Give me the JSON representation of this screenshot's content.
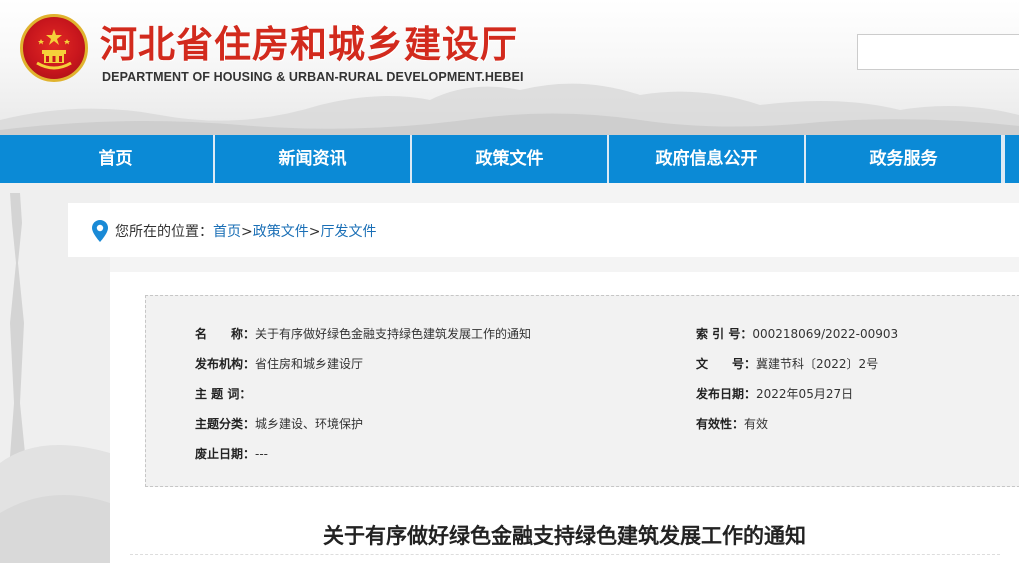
{
  "header": {
    "title": "河北省住房和城乡建设厅",
    "subtitle": "DEPARTMENT OF HOUSING & URBAN-RURAL DEVELOPMENT.HEBEI",
    "search_placeholder": ""
  },
  "nav": {
    "items": [
      "首页",
      "新闻资讯",
      "政策文件",
      "政府信息公开",
      "政务服务"
    ]
  },
  "breadcrumb": {
    "prefix": "您所在的位置：",
    "items": [
      "首页",
      "政策文件",
      "厅发文件"
    ],
    "separator": ">"
  },
  "info": {
    "name_label": "名　　称：",
    "name_value": "关于有序做好绿色金融支持绿色建筑发展工作的通知",
    "index_label": "索 引 号：",
    "index_value": "000218069/2022-00903",
    "org_label": "发布机构：",
    "org_value": "省住房和城乡建设厅",
    "docno_label": "文　　号：",
    "docno_value": "冀建节科〔2022〕2号",
    "subject_label": "主 题 词：",
    "subject_value": "",
    "date_label": "发布日期：",
    "date_value": "2022年05月27日",
    "category_label": "主题分类：",
    "category_value": "城乡建设、环境保护",
    "validity_label": "有效性：",
    "validity_value": "有效",
    "expire_label": "废止日期：",
    "expire_value": "---"
  },
  "document": {
    "title": "关于有序做好绿色金融支持绿色建筑发展工作的通知"
  },
  "colors": {
    "brand_red": "#d22a1d",
    "nav_blue": "#0b8ad6",
    "link_blue": "#1a6fb6"
  }
}
